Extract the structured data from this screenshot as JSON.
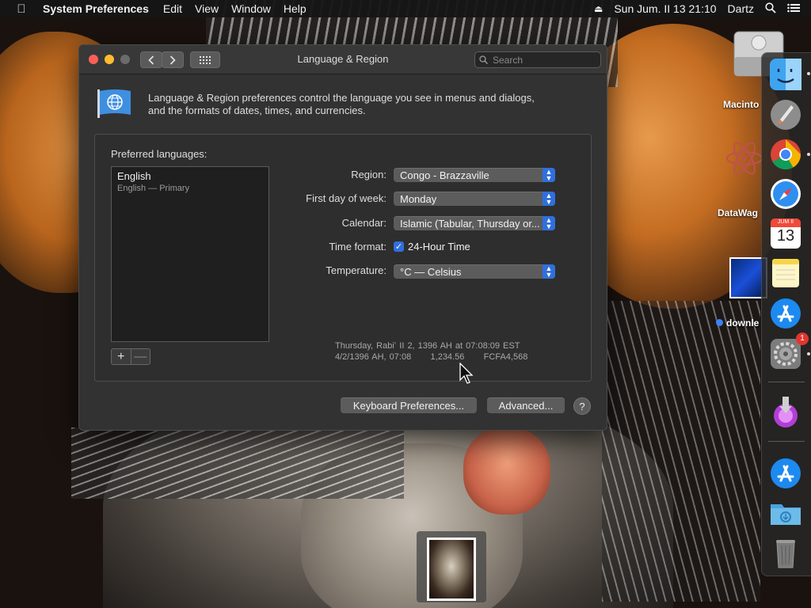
{
  "menubar": {
    "app_name": "System Preferences",
    "menus": [
      "Edit",
      "View",
      "Window",
      "Help"
    ],
    "datetime": "Sun Jum. II 13  21:10",
    "user": "Dartz"
  },
  "desktop": {
    "disk_label": "Macinto",
    "app_label": "DataWag",
    "file_label": "downle"
  },
  "dock": {
    "items": [
      "finder",
      "launchpad",
      "chrome",
      "safari",
      "calendar",
      "notes",
      "app-store",
      "system-preferences",
      "installer",
      "app-store-2",
      "downloads-folder",
      "trash"
    ],
    "calendar_month": "JUM II",
    "calendar_day": "13",
    "prefs_badge": "1"
  },
  "window": {
    "title": "Language & Region",
    "search_placeholder": "Search",
    "intro_line1": "Language & Region preferences control the language you see in menus and dialogs,",
    "intro_line2": "and the formats of dates, times, and currencies.",
    "preferred_languages_label": "Preferred languages:",
    "languages": [
      {
        "name": "English",
        "detail": "English — Primary"
      }
    ],
    "add_symbol": "+",
    "remove_symbol": "—",
    "region_label": "Region:",
    "region_value": "Congo - Brazzaville",
    "first_day_label": "First day of week:",
    "first_day_value": "Monday",
    "calendar_label": "Calendar:",
    "calendar_value": "Islamic (Tabular, Thursday or...",
    "time_format_label": "Time format:",
    "time_format_option": "24-Hour Time",
    "time_format_checked": true,
    "temperature_label": "Temperature:",
    "temperature_value": "°C — Celsius",
    "sample_line1": "Thursday, Rabiʻ II 2, 1396 AH at 07:08:09 EST",
    "sample_line2": "4/2/1396 AH, 07:08      1,234.56      FCFA4,568",
    "keyboard_prefs_button": "Keyboard Preferences...",
    "advanced_button": "Advanced...",
    "help_symbol": "?"
  },
  "colors": {
    "accent": "#2f6fde",
    "close": "#fe5f57",
    "minimize": "#febc2e",
    "zoom": "#6b6b6b"
  }
}
